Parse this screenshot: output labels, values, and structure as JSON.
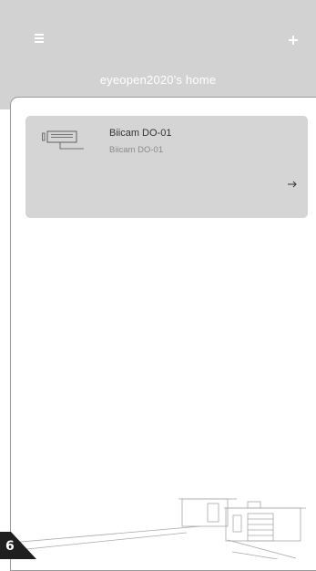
{
  "header": {
    "title": "eyeopen2020's home",
    "menu_icon": "menu-icon",
    "add_icon": "plus-icon",
    "background": "#d2d2d2"
  },
  "devices": [
    {
      "name": "Biicam DO-01",
      "model": "Biicam DO-01",
      "icon": "camera-icon",
      "action_icon": "arrow-right-icon"
    }
  ],
  "footer": {
    "page_number": "6",
    "illustration": "house-illustration"
  }
}
